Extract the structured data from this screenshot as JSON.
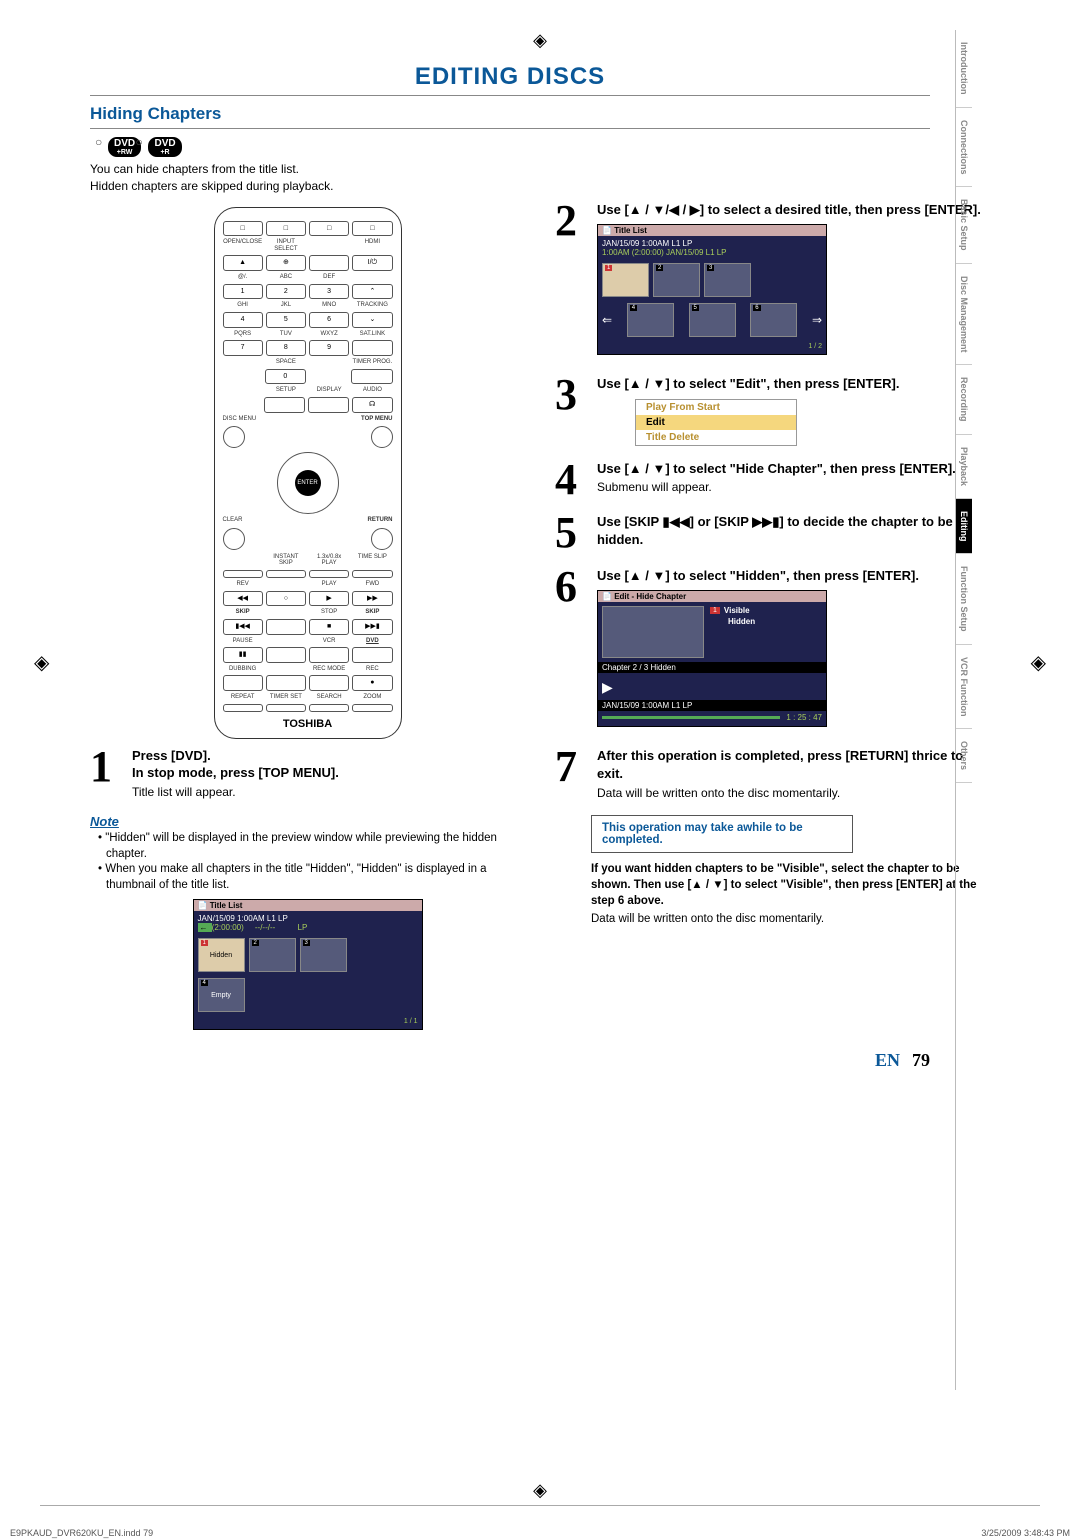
{
  "header": {
    "main_title": "EDITING DISCS",
    "section_title": "Hiding Chapters",
    "badges": [
      {
        "label": "DVD",
        "sub": "+RW"
      },
      {
        "label": "DVD",
        "sub": "+R"
      }
    ],
    "intro_line1": "You can hide chapters from the title list.",
    "intro_line2": "Hidden chapters are skipped during playback."
  },
  "remote": {
    "labels_row1": [
      "OPEN/CLOSE",
      "INPUT SELECT",
      "",
      "HDMI"
    ],
    "labels_row2": [
      "@/.",
      "ABC",
      "DEF",
      ""
    ],
    "nums_row2": [
      "1",
      "2",
      "3",
      "⌃"
    ],
    "labels_row3": [
      "GHI",
      "JKL",
      "MNO",
      "TRACKING"
    ],
    "nums_row3": [
      "4",
      "5",
      "6",
      "⌄"
    ],
    "labels_row4": [
      "PQRS",
      "TUV",
      "WXYZ",
      "SAT.LINK"
    ],
    "nums_row4": [
      "7",
      "8",
      "9",
      ""
    ],
    "space_label": "SPACE",
    "zero": "0",
    "timer_label": "TIMER PROG.",
    "labels_row5": [
      "",
      "SETUP",
      "DISPLAY",
      "AUDIO"
    ],
    "disc_menu": "DISC MENU",
    "top_menu": "TOP MENU",
    "clear": "CLEAR",
    "return": "RETURN",
    "labels_row6": [
      "",
      "INSTANT SKIP",
      "1.3x/0.8x PLAY",
      "TIME SLIP"
    ],
    "labels_row7": [
      "REV",
      "",
      "PLAY",
      "FWD"
    ],
    "nums_row7": [
      "◀◀",
      "○",
      "▶",
      "▶▶"
    ],
    "labels_row8": [
      "SKIP",
      "",
      "STOP",
      "SKIP"
    ],
    "nums_row8": [
      "▮◀◀",
      "",
      "■",
      "▶▶▮"
    ],
    "labels_row9": [
      "PAUSE",
      "",
      "VCR",
      "DVD"
    ],
    "nums_row9": [
      "▮▮",
      "",
      "",
      ""
    ],
    "labels_row10": [
      "DUBBING",
      "",
      "REC MODE",
      "REC"
    ],
    "nums_row10": [
      "",
      "",
      "",
      "●"
    ],
    "labels_row11": [
      "REPEAT",
      "TIMER SET",
      "SEARCH",
      "ZOOM"
    ],
    "brand": "TOSHIBA"
  },
  "steps": [
    {
      "num": "1",
      "headline": "Press [DVD].\nIn stop mode, press [TOP MENU].",
      "sub": "Title list will appear."
    },
    {
      "num": "2",
      "headline": "Use [▲ / ▼/◀ / ▶] to select a desired title, then press [ENTER].",
      "sub": ""
    },
    {
      "num": "3",
      "headline": "Use [▲ / ▼] to select \"Edit\", then press [ENTER].",
      "sub": ""
    },
    {
      "num": "4",
      "headline": "Use [▲ / ▼] to select \"Hide Chapter\", then press [ENTER].",
      "sub": "Submenu will appear."
    },
    {
      "num": "5",
      "headline": "Use [SKIP ▮◀◀] or [SKIP ▶▶▮] to decide the chapter to be hidden.",
      "sub": ""
    },
    {
      "num": "6",
      "headline": "Use [▲ / ▼] to select \"Hidden\", then press [ENTER].",
      "sub": ""
    },
    {
      "num": "7",
      "headline": "After this operation is completed, press [RETURN] thrice to exit.",
      "sub": "Data will be written onto the disc momentarily."
    }
  ],
  "note": {
    "heading": "Note",
    "items": [
      "• \"Hidden\" will be displayed in the preview window while previewing the hidden chapter.",
      "• When you make all chapters in the title \"Hidden\", \"Hidden\" is displayed in a thumbnail of the title list."
    ]
  },
  "screen_note": {
    "title": "Title List",
    "header": "JAN/15/09 1:00AM L1 LP",
    "row1": "(2:00:00)",
    "thumbs": [
      {
        "idx": "1",
        "label": "Hidden",
        "sel": true
      },
      {
        "idx": "2",
        "label": ""
      },
      {
        "idx": "3",
        "label": ""
      }
    ],
    "thumbs2": [
      {
        "idx": "4",
        "label": "Empty"
      }
    ],
    "page": "1 / 1"
  },
  "screen_step2": {
    "title": "Title List",
    "header": "JAN/15/09 1:00AM   L1   LP",
    "header2": "1:00AM (2:00:00)    JAN/15/09      L1   LP",
    "thumbs1": [
      {
        "idx": "1",
        "sel": true
      },
      {
        "idx": "2"
      },
      {
        "idx": "3"
      }
    ],
    "thumbs2": [
      {
        "idx": "4"
      },
      {
        "idx": "5"
      },
      {
        "idx": "6"
      }
    ],
    "page": "1 / 2"
  },
  "menu3": {
    "items": [
      "Play From Start",
      "Edit",
      "Title Delete"
    ]
  },
  "screen_step6": {
    "title": "Edit - Hide Chapter",
    "options": [
      "Visible",
      "Hidden"
    ],
    "active_idx": "1",
    "chapter": "Chapter   2 / 3   Hidden",
    "footer": "JAN/15/09 1:00AM L1   LP",
    "time": "1 : 25 : 47"
  },
  "infobox": "This operation may take awhile to be completed.",
  "visible_note": {
    "bold": "If you want hidden chapters to be \"Visible\", select the chapter to be shown. Then use [▲ / ▼] to select \"Visible\", then press [ENTER] at the step 6 above.",
    "sub": "Data will be written onto the disc momentarily."
  },
  "sidebar": {
    "tabs": [
      "Introduction",
      "Connections",
      "Basic Setup",
      "Disc Management",
      "Recording",
      "Playback",
      "Editing",
      "Function Setup",
      "VCR Function",
      "Others"
    ],
    "active": "Editing"
  },
  "page": {
    "lang": "EN",
    "num": "79"
  },
  "footer": {
    "left": "E9PKAUD_DVR620KU_EN.indd   79",
    "right": "3/25/2009   3:48:43 PM"
  }
}
